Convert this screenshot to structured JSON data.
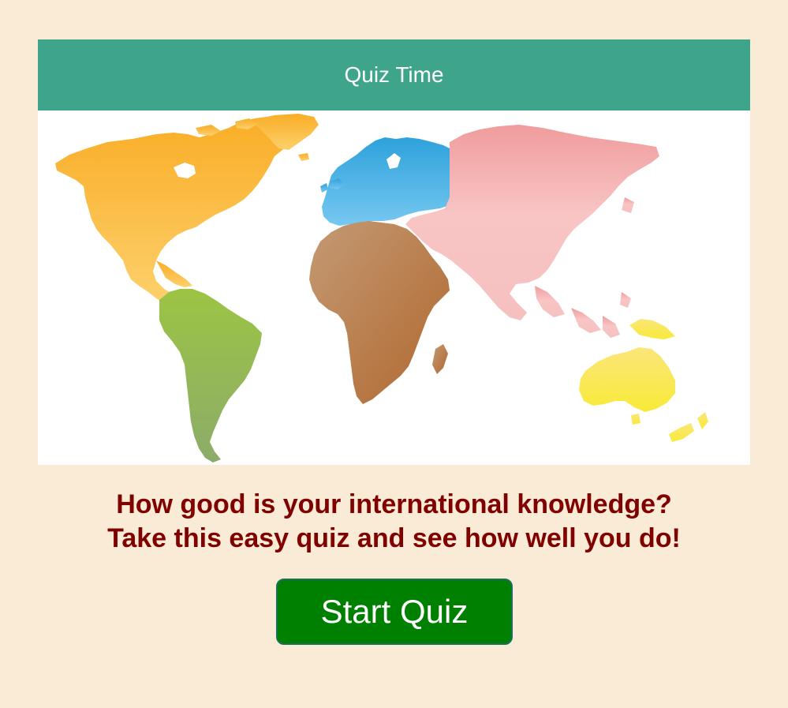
{
  "header": {
    "title": "Quiz Time"
  },
  "map": {
    "regions": [
      {
        "name": "north-america",
        "color": "#fbb02e"
      },
      {
        "name": "south-america",
        "color": "#96be49"
      },
      {
        "name": "europe",
        "color": "#3aa9e0"
      },
      {
        "name": "africa",
        "color": "#b7794a"
      },
      {
        "name": "asia",
        "color": "#f4b4b4"
      },
      {
        "name": "oceania",
        "color": "#f9e84a"
      }
    ]
  },
  "intro": {
    "line1": "How good is your international knowledge?",
    "line2": "Take this easy quiz and see how well you do!"
  },
  "start_button": {
    "label": "Start Quiz"
  },
  "colors": {
    "page_background": "#faebd7",
    "header_background": "#3fa58a",
    "text_accent": "#800000",
    "button_background": "#008000"
  }
}
